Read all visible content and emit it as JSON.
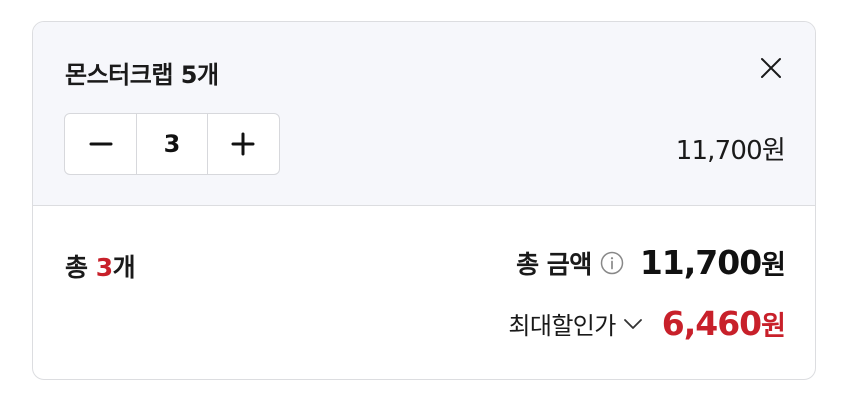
{
  "item": {
    "title": "몬스터크랩 5개",
    "quantity": "3",
    "price": "11,700원"
  },
  "summary": {
    "count_prefix": "총 ",
    "count_value": "3",
    "count_suffix": "개",
    "total_label": "총 금액",
    "total_amount": "11,700",
    "total_unit": "원",
    "discount_label": "최대할인가",
    "discount_amount": "6,460",
    "discount_unit": "원"
  },
  "icons": {
    "close": "close-icon",
    "minus": "minus-icon",
    "plus": "plus-icon",
    "info": "info-icon",
    "chevron": "chevron-down-icon"
  },
  "colors": {
    "accent": "#c8202a",
    "item_background": "#f6f7fb",
    "border": "#dcdde0"
  }
}
